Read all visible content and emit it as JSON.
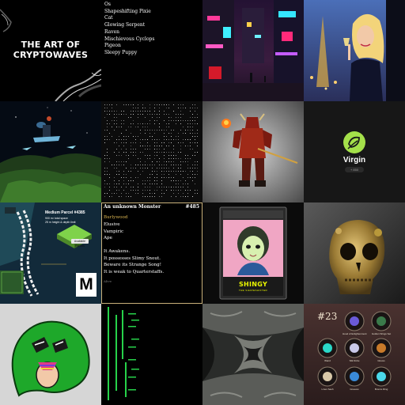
{
  "tiles": {
    "t1": {
      "title_line1": "THE ART OF",
      "title_line2": "CRYPTOWAVES"
    },
    "t2": {
      "items": [
        "Os",
        "Shapeshifting Pixie",
        "Cat",
        "Glowing Serpent",
        "Raven",
        "Mischievous Cyclops",
        "Pigeon",
        "Sleepy Puppy"
      ]
    },
    "t8": {
      "label": "Virgin",
      "sub": "+ 850"
    },
    "t9": {
      "name": "Medium Parcel #4385",
      "desc_line1": "900 m² total space",
      "desc_line2": "25 m height & depth limit",
      "button": "Available Parcels",
      "logo": "M"
    },
    "t10": {
      "heading": "An unknown Monster",
      "number": "#485",
      "gold_line": "Burlywood",
      "lines": [
        "Elusive",
        "Vampiric",
        "Ape",
        "",
        "It Awakens.",
        "It possesses Slimy Snout.",
        "Beware its Strange Song!",
        "It is weak to Quarterstaffs."
      ],
      "footer": "Alive"
    },
    "t11": {
      "name": "SHINGY",
      "sub": "THE SHAPESHIFTER"
    },
    "t16": {
      "number": "#23",
      "labels": [
        "Hood of Enlightenment",
        "Golden Wings Set",
        "Wand",
        "Silk Robe",
        "Gloves",
        "Linen Sash",
        "Greaves",
        "Bronze Ring"
      ]
    }
  },
  "colors": {
    "accent_green": "#a4e04a",
    "gold": "#d9b451",
    "matrix_green": "#27d24a",
    "shingy_yellow": "#e8f400"
  }
}
